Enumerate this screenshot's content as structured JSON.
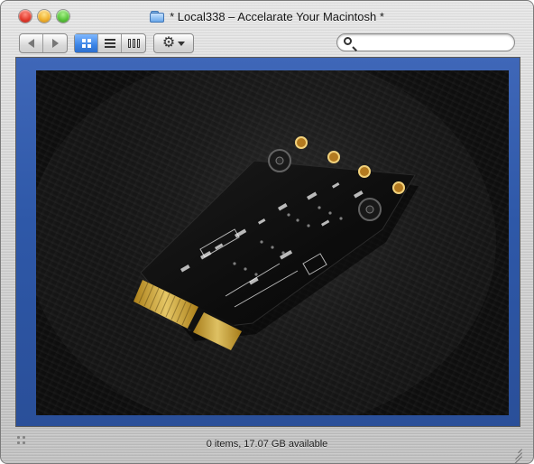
{
  "window": {
    "title": "* Local338 – Accelarate Your Macintosh *",
    "icons": {
      "close": "close-icon",
      "minimize": "minimize-icon",
      "zoom": "zoom-icon",
      "folder": "folder-icon"
    }
  },
  "toolbar": {
    "nav": {
      "back": "back-arrow-icon",
      "forward": "forward-arrow-icon"
    },
    "views": {
      "active": "icon-view",
      "items": [
        "icon-view",
        "list-view",
        "column-view"
      ]
    },
    "action": {
      "icon": "gear-icon",
      "menu": "chevron-down-icon"
    },
    "search": {
      "value": "",
      "placeholder": ""
    }
  },
  "content": {
    "image_alt": "Network adapter circuit board photo on black leather"
  },
  "status": {
    "text": "0 items, 17.07 GB available"
  },
  "colors": {
    "accent_blue": "#3b84e6",
    "content_background": "#2e58a8"
  }
}
